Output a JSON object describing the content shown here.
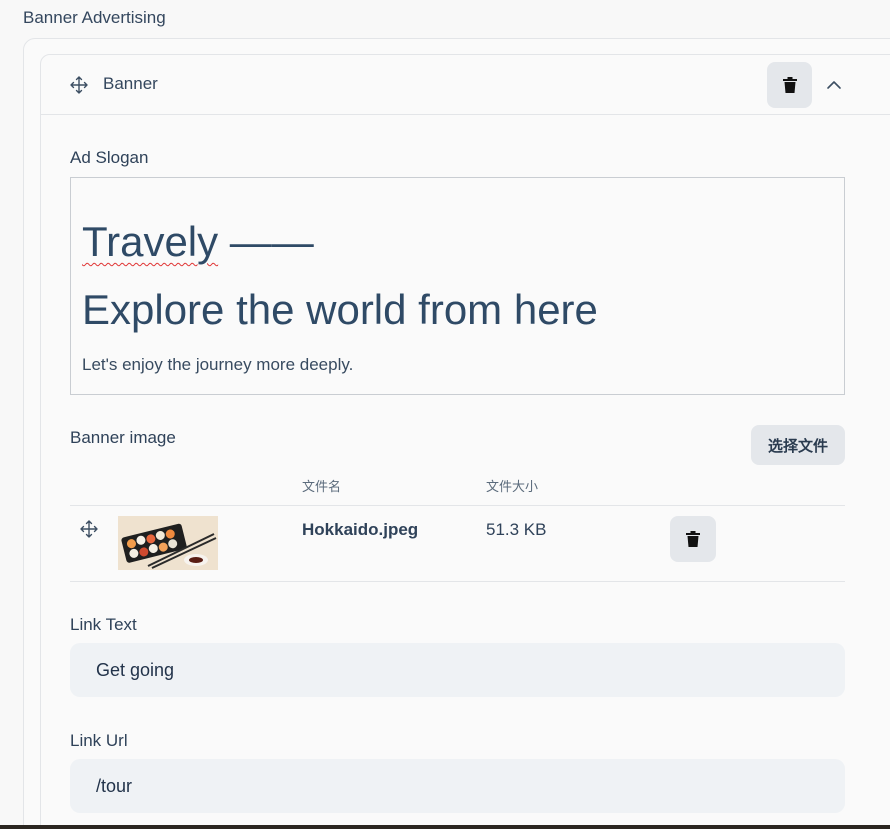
{
  "section": {
    "title": "Banner Advertising"
  },
  "block": {
    "title": "Banner"
  },
  "ad_slogan": {
    "label": "Ad Slogan",
    "line1_word": "Travely",
    "line1_rest": " ——",
    "line2": "Explore the world from here",
    "paragraph": "Let's enjoy the journey more deeply."
  },
  "banner_image": {
    "label": "Banner image",
    "choose_file_label": "选择文件",
    "columns": {
      "file_name": "文件名",
      "file_size": "文件大小"
    },
    "files": [
      {
        "name": "Hokkaido.jpeg",
        "size": "51.3 KB"
      }
    ]
  },
  "link_text": {
    "label": "Link Text",
    "value": "Get going"
  },
  "link_url": {
    "label": "Link Url",
    "value": "/tour"
  }
}
